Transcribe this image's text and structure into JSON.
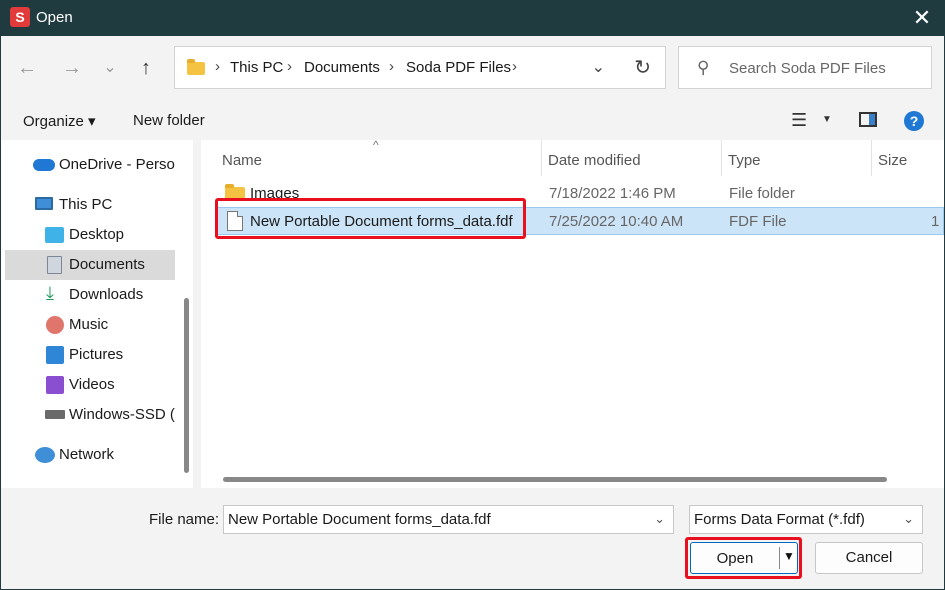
{
  "window": {
    "app_icon_letter": "S",
    "title": "Open",
    "close_glyph": "✕"
  },
  "nav": {
    "back_glyph": "←",
    "forward_glyph": "→",
    "recent_glyph": "⌄",
    "up_glyph": "↑"
  },
  "address": {
    "crumbs": [
      "This PC",
      "Documents",
      "Soda PDF Files"
    ],
    "separator": "›",
    "dropdown_glyph": "⌄",
    "refresh_glyph": "↻"
  },
  "search": {
    "placeholder": "Search Soda PDF Files",
    "icon_glyph": "⚲"
  },
  "toolbar": {
    "organize_label": "Organize ▾",
    "new_folder_label": "New folder",
    "view_glyph": "☰",
    "view_caret": "▼",
    "help_glyph": "?"
  },
  "sidebar": {
    "items": [
      {
        "label": "OneDrive - Personal",
        "icon": "cloud-icon"
      },
      {
        "label": "This PC",
        "icon": "computer-icon"
      },
      {
        "label": "Desktop",
        "icon": "desktop-icon"
      },
      {
        "label": "Documents",
        "icon": "documents-icon",
        "selected": true
      },
      {
        "label": "Downloads",
        "icon": "download-icon"
      },
      {
        "label": "Music",
        "icon": "music-icon"
      },
      {
        "label": "Pictures",
        "icon": "pictures-icon"
      },
      {
        "label": "Videos",
        "icon": "videos-icon"
      },
      {
        "label": "Windows-SSD (C:)",
        "icon": "drive-icon"
      },
      {
        "label": "Network",
        "icon": "network-icon"
      }
    ]
  },
  "files": {
    "columns": [
      "Name",
      "Date modified",
      "Type",
      "Size"
    ],
    "sort_glyph": "^",
    "rows": [
      {
        "name": "Images",
        "date": "7/18/2022 1:46 PM",
        "type": "File folder",
        "size": ""
      },
      {
        "name": "New Portable Document forms_data.fdf",
        "date": "7/25/2022 10:40 AM",
        "type": "FDF File",
        "size": "1"
      }
    ]
  },
  "footer": {
    "file_name_label": "File name:",
    "file_name_value": "New Portable Document forms_data.fdf",
    "file_type_value": "Forms Data Format (*.fdf)",
    "dropdown_glyph": "⌄",
    "open_label": "Open",
    "open_caret": "▼",
    "cancel_label": "Cancel"
  },
  "colors": {
    "titlebar": "#1f3b40",
    "accent": "#0067c0",
    "selection": "#cce4f7",
    "highlight": "#e8101e"
  }
}
